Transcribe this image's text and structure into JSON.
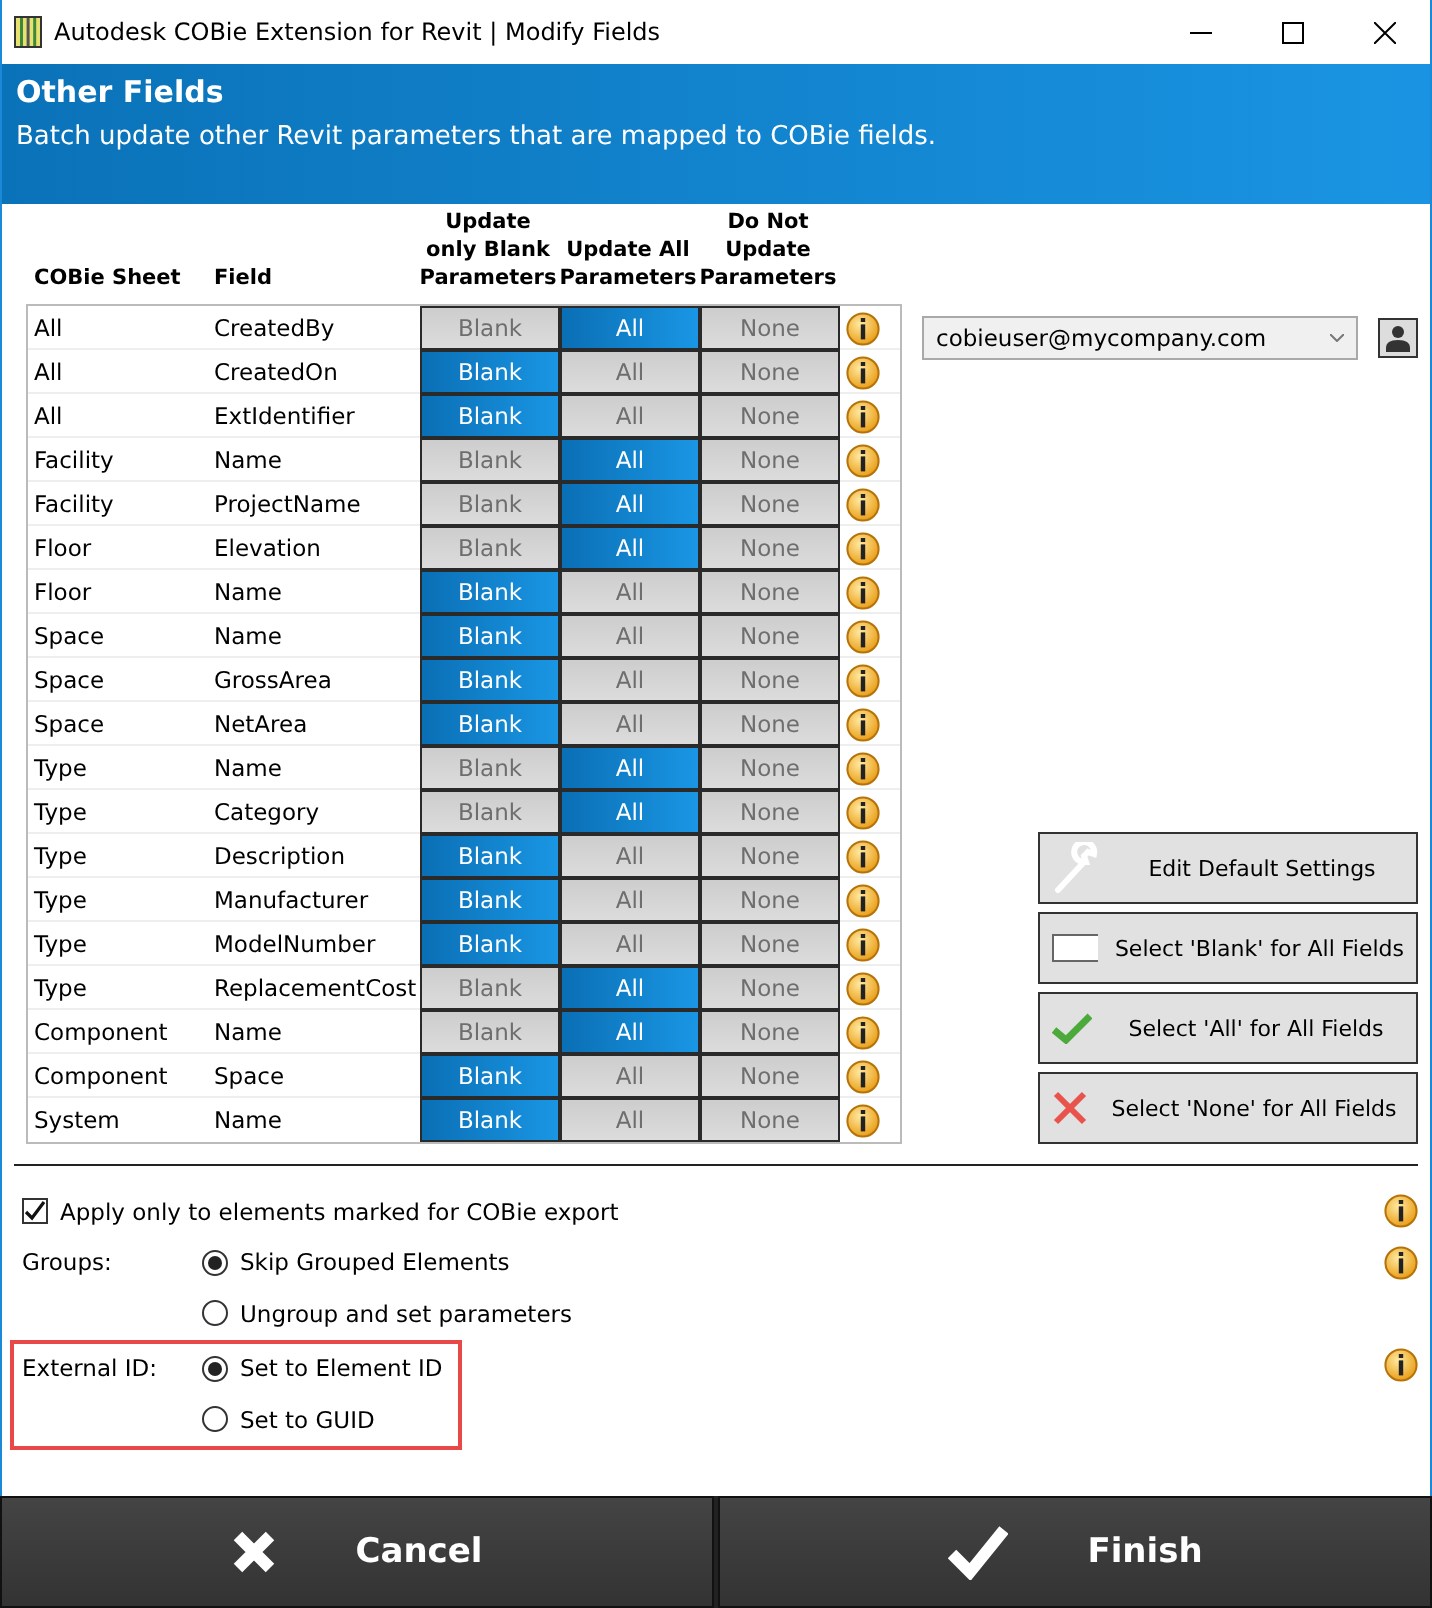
{
  "window": {
    "title": "Autodesk COBie Extension for Revit | Modify Fields"
  },
  "header": {
    "title": "Other Fields",
    "subtitle": "Batch update other Revit parameters that are mapped to COBie fields."
  },
  "table": {
    "columns": [
      "COBie Sheet",
      "Field",
      "Update only Blank Parameters",
      "Update All Parameters",
      "Do Not Update Parameters"
    ],
    "rows": [
      {
        "sheet": "All",
        "field": "CreatedBy",
        "options": [
          {
            "label": "Blank",
            "selected": false
          },
          {
            "label": "All",
            "selected": true
          },
          {
            "label": "None",
            "selected": false
          }
        ]
      },
      {
        "sheet": "All",
        "field": "CreatedOn",
        "options": [
          {
            "label": "Blank",
            "selected": true
          },
          {
            "label": "All",
            "selected": false
          },
          {
            "label": "None",
            "selected": false
          }
        ]
      },
      {
        "sheet": "All",
        "field": "ExtIdentifier",
        "options": [
          {
            "label": "Blank",
            "selected": true
          },
          {
            "label": "All",
            "selected": false
          },
          {
            "label": "None",
            "selected": false
          }
        ]
      },
      {
        "sheet": "Facility",
        "field": "Name",
        "options": [
          {
            "label": "Blank",
            "selected": false
          },
          {
            "label": "All",
            "selected": true
          },
          {
            "label": "None",
            "selected": false
          }
        ]
      },
      {
        "sheet": "Facility",
        "field": "ProjectName",
        "options": [
          {
            "label": "Blank",
            "selected": false
          },
          {
            "label": "All",
            "selected": true
          },
          {
            "label": "None",
            "selected": false
          }
        ]
      },
      {
        "sheet": "Floor",
        "field": "Elevation",
        "options": [
          {
            "label": "Blank",
            "selected": false
          },
          {
            "label": "All",
            "selected": true
          },
          {
            "label": "None",
            "selected": false
          }
        ]
      },
      {
        "sheet": "Floor",
        "field": "Name",
        "options": [
          {
            "label": "Blank",
            "selected": true
          },
          {
            "label": "All",
            "selected": false
          },
          {
            "label": "None",
            "selected": false
          }
        ]
      },
      {
        "sheet": "Space",
        "field": "Name",
        "options": [
          {
            "label": "Blank",
            "selected": true
          },
          {
            "label": "All",
            "selected": false
          },
          {
            "label": "None",
            "selected": false
          }
        ]
      },
      {
        "sheet": "Space",
        "field": "GrossArea",
        "options": [
          {
            "label": "Blank",
            "selected": true
          },
          {
            "label": "All",
            "selected": false
          },
          {
            "label": "None",
            "selected": false
          }
        ]
      },
      {
        "sheet": "Space",
        "field": "NetArea",
        "options": [
          {
            "label": "Blank",
            "selected": true
          },
          {
            "label": "All",
            "selected": false
          },
          {
            "label": "None",
            "selected": false
          }
        ]
      },
      {
        "sheet": "Type",
        "field": "Name",
        "options": [
          {
            "label": "Blank",
            "selected": false
          },
          {
            "label": "All",
            "selected": true
          },
          {
            "label": "None",
            "selected": false
          }
        ]
      },
      {
        "sheet": "Type",
        "field": "Category",
        "options": [
          {
            "label": "Blank",
            "selected": false
          },
          {
            "label": "All",
            "selected": true
          },
          {
            "label": "None",
            "selected": false
          }
        ]
      },
      {
        "sheet": "Type",
        "field": "Description",
        "options": [
          {
            "label": "Blank",
            "selected": true
          },
          {
            "label": "All",
            "selected": false
          },
          {
            "label": "None",
            "selected": false
          }
        ]
      },
      {
        "sheet": "Type",
        "field": "Manufacturer",
        "options": [
          {
            "label": "Blank",
            "selected": true
          },
          {
            "label": "All",
            "selected": false
          },
          {
            "label": "None",
            "selected": false
          }
        ]
      },
      {
        "sheet": "Type",
        "field": "ModelNumber",
        "options": [
          {
            "label": "Blank",
            "selected": true
          },
          {
            "label": "All",
            "selected": false
          },
          {
            "label": "None",
            "selected": false
          }
        ]
      },
      {
        "sheet": "Type",
        "field": "ReplacementCost",
        "options": [
          {
            "label": "Blank",
            "selected": false
          },
          {
            "label": "All",
            "selected": true
          },
          {
            "label": "None",
            "selected": false
          }
        ]
      },
      {
        "sheet": "Component",
        "field": "Name",
        "options": [
          {
            "label": "Blank",
            "selected": false
          },
          {
            "label": "All",
            "selected": true
          },
          {
            "label": "None",
            "selected": false
          }
        ]
      },
      {
        "sheet": "Component",
        "field": "Space",
        "options": [
          {
            "label": "Blank",
            "selected": true
          },
          {
            "label": "All",
            "selected": false
          },
          {
            "label": "None",
            "selected": false
          }
        ]
      },
      {
        "sheet": "System",
        "field": "Name",
        "options": [
          {
            "label": "Blank",
            "selected": true
          },
          {
            "label": "All",
            "selected": false
          },
          {
            "label": "None",
            "selected": false
          }
        ]
      }
    ]
  },
  "user_dropdown": {
    "value": "cobieuser@mycompany.com"
  },
  "side_buttons": [
    {
      "kind": "wrench",
      "label": "Edit Default Settings"
    },
    {
      "kind": "blank",
      "label": "Select 'Blank' for All Fields"
    },
    {
      "kind": "check",
      "label": "Select 'All' for All Fields"
    },
    {
      "kind": "cross",
      "label": "Select 'None' for All Fields"
    }
  ],
  "apply_only_marked": {
    "label": "Apply only to elements marked for COBie export",
    "checked": true
  },
  "groups": {
    "label": "Groups:",
    "options": [
      {
        "label": "Skip Grouped Elements",
        "selected": true
      },
      {
        "label": "Ungroup and set parameters",
        "selected": false
      }
    ]
  },
  "external_id": {
    "label": "External ID:",
    "highlighted": true,
    "options": [
      {
        "label": "Set to Element ID",
        "selected": true
      },
      {
        "label": "Set to GUID",
        "selected": false
      }
    ]
  },
  "footer_buttons": [
    {
      "kind": "cancel",
      "label": "Cancel"
    },
    {
      "kind": "finish",
      "label": "Finish"
    }
  ]
}
